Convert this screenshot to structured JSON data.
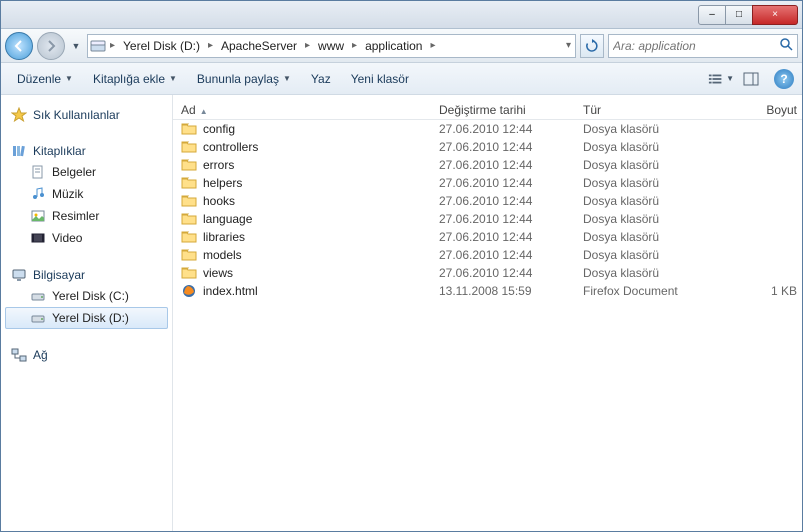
{
  "window": {
    "minimize": "–",
    "maximize": "□",
    "close": "×"
  },
  "breadcrumb": [
    "Yerel Disk (D:)",
    "ApacheServer",
    "www",
    "application"
  ],
  "search": {
    "placeholder": "Ara: application"
  },
  "toolbar": {
    "organize": "Düzenle",
    "library": "Kitaplığa ekle",
    "share": "Bununla paylaş",
    "burn": "Yaz",
    "newfolder": "Yeni klasör"
  },
  "sidebar": {
    "favorites": "Sık Kullanılanlar",
    "libraries": "Kitaplıklar",
    "lib_items": {
      "docs": "Belgeler",
      "music": "Müzik",
      "pics": "Resimler",
      "video": "Video"
    },
    "computer": "Bilgisayar",
    "drives": {
      "c": "Yerel Disk (C:)",
      "d": "Yerel Disk (D:)"
    },
    "network": "Ağ"
  },
  "columns": {
    "name": "Ad",
    "modified": "Değiştirme tarihi",
    "type": "Tür",
    "size": "Boyut"
  },
  "files": [
    {
      "name": "config",
      "modified": "27.06.2010 12:44",
      "type": "Dosya klasörü",
      "size": "",
      "kind": "folder"
    },
    {
      "name": "controllers",
      "modified": "27.06.2010 12:44",
      "type": "Dosya klasörü",
      "size": "",
      "kind": "folder"
    },
    {
      "name": "errors",
      "modified": "27.06.2010 12:44",
      "type": "Dosya klasörü",
      "size": "",
      "kind": "folder"
    },
    {
      "name": "helpers",
      "modified": "27.06.2010 12:44",
      "type": "Dosya klasörü",
      "size": "",
      "kind": "folder"
    },
    {
      "name": "hooks",
      "modified": "27.06.2010 12:44",
      "type": "Dosya klasörü",
      "size": "",
      "kind": "folder"
    },
    {
      "name": "language",
      "modified": "27.06.2010 12:44",
      "type": "Dosya klasörü",
      "size": "",
      "kind": "folder"
    },
    {
      "name": "libraries",
      "modified": "27.06.2010 12:44",
      "type": "Dosya klasörü",
      "size": "",
      "kind": "folder"
    },
    {
      "name": "models",
      "modified": "27.06.2010 12:44",
      "type": "Dosya klasörü",
      "size": "",
      "kind": "folder"
    },
    {
      "name": "views",
      "modified": "27.06.2010 12:44",
      "type": "Dosya klasörü",
      "size": "",
      "kind": "folder"
    },
    {
      "name": "index.html",
      "modified": "13.11.2008 15:59",
      "type": "Firefox Document",
      "size": "1 KB",
      "kind": "firefox"
    }
  ]
}
